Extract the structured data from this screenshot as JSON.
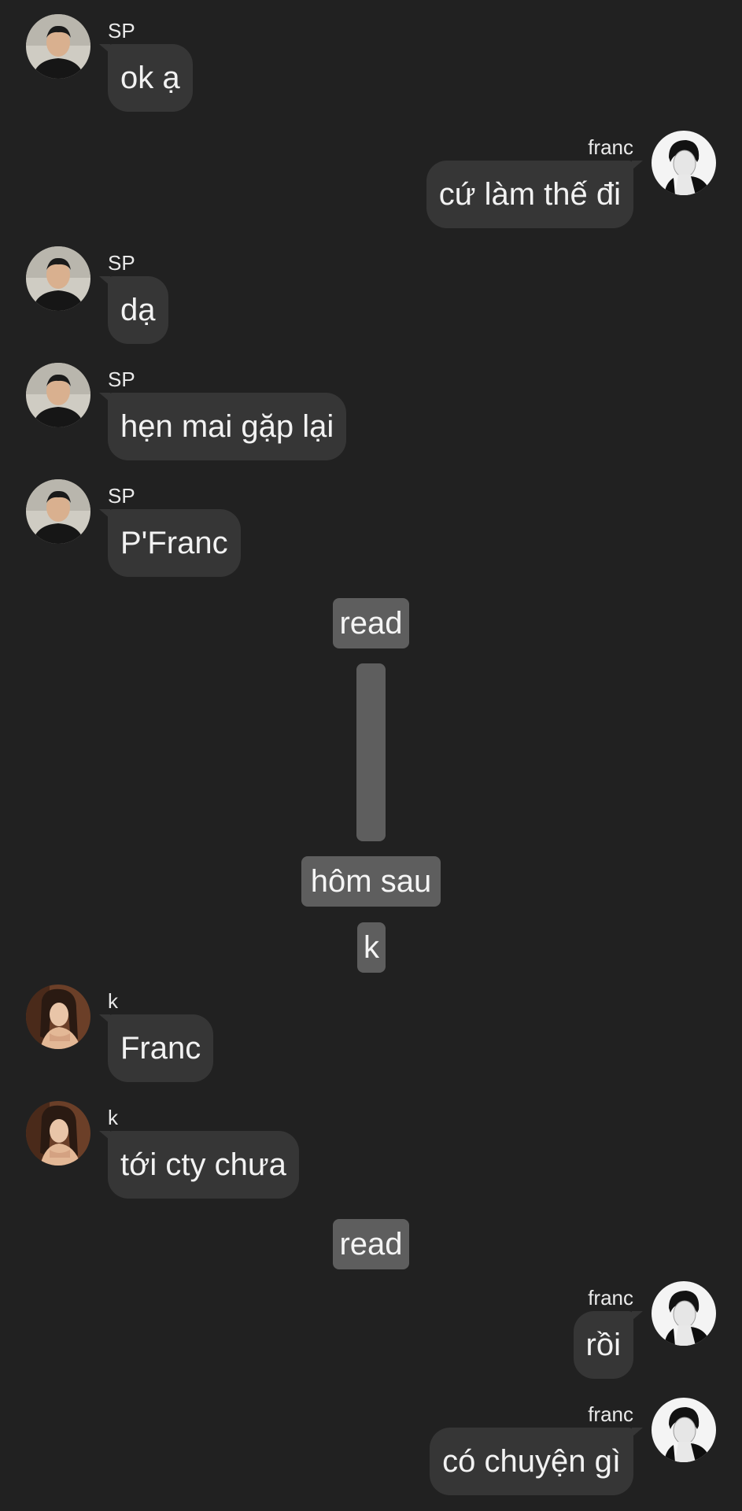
{
  "users": {
    "sp": {
      "name": "SP"
    },
    "franc": {
      "name": "franc"
    },
    "k": {
      "name": "k"
    }
  },
  "messages": [
    {
      "sender": "SP",
      "text": "ok ạ"
    },
    {
      "sender": "franc",
      "text": "cứ làm thế đi"
    },
    {
      "sender": "SP",
      "text": "dạ"
    },
    {
      "sender": "SP",
      "text": "hẹn mai gặp lại"
    },
    {
      "sender": "SP",
      "text": "P'Franc"
    },
    {
      "sender": "k",
      "text": "Franc"
    },
    {
      "sender": "k",
      "text": "tới cty chưa"
    },
    {
      "sender": "franc",
      "text": "rồi"
    },
    {
      "sender": "franc",
      "text": "có chuyện gì"
    }
  ],
  "system": {
    "read_1": "read",
    "time_skip": "hôm sau",
    "speaker_k": "k",
    "read_2": "read"
  },
  "colors": {
    "background": "#212121",
    "bubble": "#363636",
    "system_pill": "#5e5e5e",
    "text": "#f2f2f2"
  }
}
